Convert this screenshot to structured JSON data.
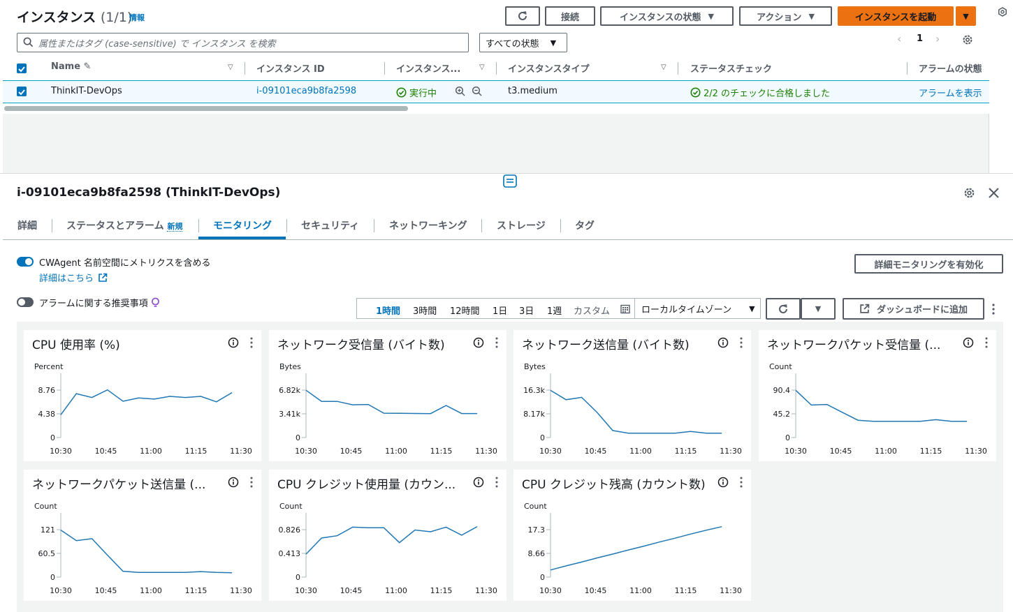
{
  "header": {
    "title": "インスタンス",
    "count": "(1/1)",
    "info": "情報"
  },
  "toolbar": {
    "connect": "接続",
    "instance_state": "インスタンスの状態",
    "actions": "アクション",
    "launch": "インスタンスを起動"
  },
  "search": {
    "placeholder": "属性またはタグ (case-sensitive) で インスタンス を検索",
    "state_filter": "すべての状態"
  },
  "pager": {
    "page": "1"
  },
  "table": {
    "headers": [
      "Name",
      "インスタンス ID",
      "インスタンス...",
      "インスタンスタイプ",
      "ステータスチェック",
      "アラームの状態"
    ],
    "row": {
      "name": "ThinkIT-DevOps",
      "id": "i-09101eca9b8fa2598",
      "state": "実行中",
      "type": "t3.medium",
      "status_check": "2/2 のチェックに合格しました",
      "alarm": "アラームを表示"
    }
  },
  "detail": {
    "title": "i-09101eca9b8fa2598 (ThinkIT-DevOps)",
    "tabs": [
      "詳細",
      "ステータスとアラーム",
      "モニタリング",
      "セキュリティ",
      "ネットワーキング",
      "ストレージ",
      "タグ"
    ],
    "new_badge": "新規",
    "active_tab": "モニタリング"
  },
  "monitoring": {
    "cwagent_label": "CWAgent 名前空間にメトリクスを含める",
    "learn_more": "詳細はこちら",
    "alarm_reco": "アラームに関する推奨事項",
    "enable_detailed": "詳細モニタリングを有効化",
    "ranges": [
      "1時間",
      "3時間",
      "12時間",
      "1日",
      "3日",
      "1週",
      "カスタム"
    ],
    "active_range": "1時間",
    "timezone": "ローカルタイムゾーン",
    "add_dashboard": "ダッシュボードに追加"
  },
  "chart_data": [
    {
      "type": "line",
      "title": "CPU 使用率 (%)",
      "ylabel": "Percent",
      "x": [
        "10:30",
        "10:33",
        "10:36",
        "10:39",
        "10:42",
        "10:45",
        "10:48",
        "10:51",
        "10:54",
        "10:57",
        "11:00",
        "11:03",
        "11:06",
        "11:09",
        "11:12",
        "11:15",
        "11:18",
        "11:21",
        "11:24",
        "11:27"
      ],
      "xticks": [
        "10:30",
        "10:45",
        "11:00",
        "11:15",
        "11:30"
      ],
      "yticks": [
        "0",
        "4.38",
        "8.76"
      ],
      "ylim": [
        0,
        13.1
      ],
      "values": [
        4.2,
        8.1,
        7.4,
        8.8,
        6.7,
        7.3,
        7.1,
        7.6,
        7.4,
        7.6,
        6.6,
        8.3
      ]
    },
    {
      "type": "line",
      "title": "ネットワーク受信量 (バイト数)",
      "ylabel": "Bytes",
      "xticks": [
        "10:30",
        "10:45",
        "11:00",
        "11:15",
        "11:30"
      ],
      "yticks": [
        "0",
        "3.41k",
        "6.82k"
      ],
      "ylim": [
        0,
        10200
      ],
      "values": [
        6800,
        5200,
        5200,
        4700,
        4750,
        3500,
        3480,
        3460,
        3440,
        4600,
        3450,
        3450
      ]
    },
    {
      "type": "line",
      "title": "ネットワーク送信量 (バイト数)",
      "ylabel": "Bytes",
      "xticks": [
        "10:30",
        "10:45",
        "11:00",
        "11:15",
        "11:30"
      ],
      "yticks": [
        "0",
        "8.17k",
        "16.3k"
      ],
      "ylim": [
        0,
        24500
      ],
      "values": [
        16200,
        13000,
        13800,
        8600,
        2400,
        1500,
        1500,
        1500,
        1500,
        2100,
        1500,
        1500
      ]
    },
    {
      "type": "line",
      "title": "ネットワークパケット受信量 (...",
      "ylabel": "Count",
      "xticks": [
        "10:30",
        "10:45",
        "11:00",
        "11:15",
        "11:30"
      ],
      "yticks": [
        "0",
        "45.2",
        "90.4"
      ],
      "ylim": [
        0,
        135
      ],
      "values": [
        90,
        62,
        63,
        48,
        33,
        31,
        31,
        31,
        31,
        34,
        31,
        31
      ]
    },
    {
      "type": "line",
      "title": "ネットワークパケット送信量 (...",
      "ylabel": "Count",
      "xticks": [
        "10:30",
        "10:45",
        "11:00",
        "11:15",
        "11:30"
      ],
      "yticks": [
        "0",
        "60.5",
        "121"
      ],
      "ylim": [
        0,
        181
      ],
      "values": [
        120,
        93,
        98,
        56,
        15,
        12,
        12,
        12,
        12,
        14,
        12,
        11
      ]
    },
    {
      "type": "line",
      "title": "CPU クレジット使用量 (カウン...",
      "ylabel": "Count",
      "xticks": [
        "10:30",
        "10:45",
        "11:00",
        "11:15",
        "11:30"
      ],
      "yticks": [
        "0",
        "0.413",
        "0.826"
      ],
      "ylim": [
        0,
        1.24
      ],
      "values": [
        0.4,
        0.68,
        0.72,
        0.87,
        0.86,
        0.86,
        0.6,
        0.82,
        0.79,
        0.87,
        0.73,
        0.88
      ]
    },
    {
      "type": "line",
      "title": "CPU クレジット残高 (カウント数)",
      "ylabel": "Count",
      "xticks": [
        "10:30",
        "10:45",
        "11:00",
        "11:15",
        "11:30"
      ],
      "yticks": [
        "0",
        "8.66",
        "17.3"
      ],
      "ylim": [
        0,
        26
      ],
      "values": [
        2.6,
        4.1,
        5.5,
        7.0,
        8.4,
        9.9,
        11.3,
        12.8,
        14.2,
        15.7,
        17.1,
        18.4
      ]
    }
  ]
}
